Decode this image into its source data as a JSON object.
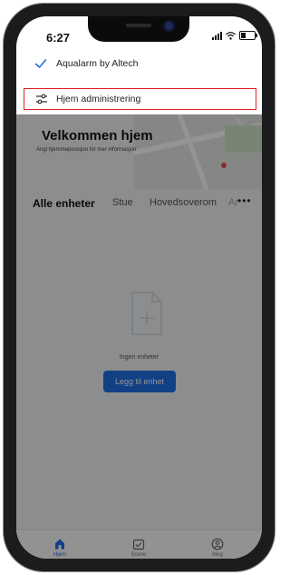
{
  "status_bar": {
    "time": "6:27"
  },
  "home": {
    "welcome_title": "Velkommen hjem",
    "welcome_subtitle": "Angi hjemmeposisjon for mer informasjon",
    "tabs": [
      {
        "label": "Alle enheter",
        "active": true
      },
      {
        "label": "Stue",
        "active": false
      },
      {
        "label": "Hovedsoverom",
        "active": false
      },
      {
        "label": "Ar",
        "active": false
      }
    ],
    "more_label": "•••",
    "empty_text": "Ingen enheter",
    "add_button": "Legg til enhet"
  },
  "dropdown": {
    "items": [
      {
        "label": "Aqualarm by Altech",
        "icon": "checkmark-icon",
        "checked": true
      },
      {
        "label": "Hjem administrering",
        "icon": "sliders-icon",
        "highlighted": true
      }
    ]
  },
  "bottom_nav": {
    "items": [
      {
        "label": "Hjem",
        "icon": "home-icon",
        "active": true
      },
      {
        "label": "Scene",
        "icon": "scene-icon",
        "active": false
      },
      {
        "label": "Meg",
        "icon": "profile-icon",
        "active": false
      }
    ]
  },
  "colors": {
    "accent": "#1f6fe5",
    "highlight_border": "#e02020",
    "overlay": "rgba(0,0,0,0.42)"
  }
}
